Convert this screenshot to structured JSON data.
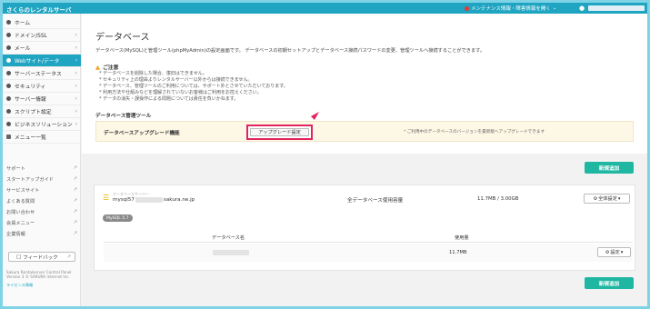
{
  "header": {
    "brand": "さくらのレンタルサーバ",
    "maintenance_label": "メンテナンス情報・障害情報を開く",
    "maintenance_chevron": "⌄",
    "user_icon": "person-icon"
  },
  "sidebar": {
    "items": [
      {
        "label": "ホーム",
        "chevron": ""
      },
      {
        "label": "ドメイン/SSL",
        "chevron": "›"
      },
      {
        "label": "メール",
        "chevron": "›"
      },
      {
        "label": "Webサイト/データ",
        "chevron": "›"
      },
      {
        "label": "サーバーステータス",
        "chevron": "›"
      },
      {
        "label": "セキュリティ",
        "chevron": "›"
      },
      {
        "label": "サーバー情報",
        "chevron": "›"
      },
      {
        "label": "スクリプト設定",
        "chevron": "›"
      },
      {
        "label": "ビジネスソリューション",
        "chevron": "›"
      },
      {
        "label": "メニュー一覧",
        "chevron": ""
      }
    ],
    "links": [
      "サポート",
      "スタートアップガイド",
      "サービスサイト",
      "よくある質問",
      "お問い合わせ",
      "会員メニュー",
      "企業情報"
    ],
    "external_icon": "↗",
    "feedback_label": "フィードバック",
    "footer_line1": "Sakura Rentalserver Control Panel",
    "footer_line2": "Version 3  © SAKURA internet Inc.",
    "footer_line3": "ライセンス情報"
  },
  "main": {
    "title": "データベース",
    "description": "データベース(MySQL)と管理ツール(phpMyAdmin)の設定画面です。 データベースの初期セットアップとデータベース接続パスワードの変更、管理ツールへ接続することができます。",
    "notice_title": "ご注意",
    "notices": [
      "データベースを削除した場合、復旧はできません。",
      "セキュリティ上の理由よりレンタルサーバー以外からは接続できません。",
      "データベース、管理ツールのご利用については、サポート外とさせていただいております。",
      "利用方法や仕組みなどを理解されていないお客様はご利用をお控えください。",
      "データの消失・誤操作による問題については責任を負いかねます。"
    ],
    "mgmt_title": "データベース管理ツール",
    "upgrade_label": "データベースアップグレード機能",
    "upgrade_button": "アップグレード設定",
    "upgrade_note": "ご利用中のデータベースのバージョンを最新版へアップグレードできます",
    "new_button": "新規追加",
    "db": {
      "small_label": "データベースサーバー",
      "name_prefix": "mysql57",
      "name_suffix": "sakura.ne.jp",
      "version_badge": "MySQL 5.7",
      "capacity_label": "全データベース使用容量",
      "capacity_value": "11.7MB / 3.00GB",
      "settings_all": "全体設定",
      "col_name": "データベース名",
      "col_usage": "使用量",
      "row_usage": "11.7MB",
      "settings": "設定"
    },
    "accent_colors": {
      "primary": "#1fa4c1",
      "add": "#20b7a2",
      "highlight": "#e0245e"
    }
  }
}
